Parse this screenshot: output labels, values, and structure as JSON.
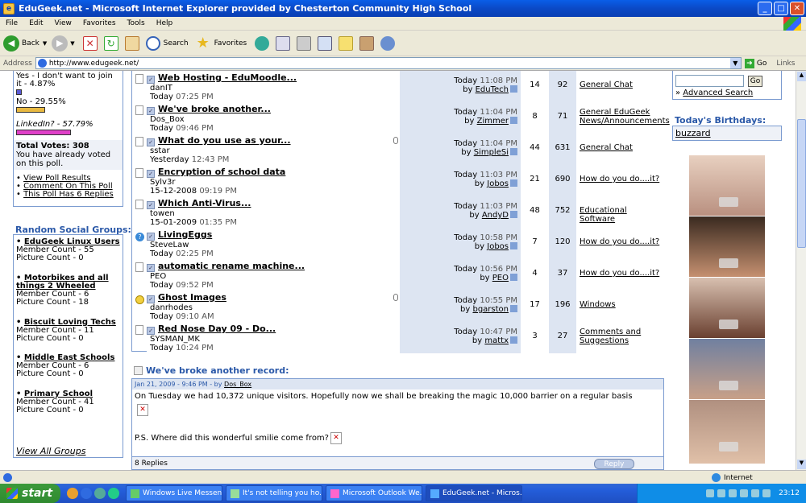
{
  "window": {
    "title": "EduGeek.net - Microsoft Internet Explorer provided by Chesterton Community High School"
  },
  "menu": [
    "File",
    "Edit",
    "View",
    "Favorites",
    "Tools",
    "Help"
  ],
  "toolbar": {
    "back": "Back",
    "search": "Search",
    "favorites": "Favorites"
  },
  "address": {
    "label": "Address",
    "url": "http://www.edugeek.net/",
    "go": "Go",
    "links": "Links"
  },
  "poll": {
    "options": [
      {
        "text": "Yes - I don't want to join it - 4.87%",
        "pct": 4.87,
        "color": "#5a5ad8"
      },
      {
        "text": "No - 29.55%",
        "pct": 29.55,
        "color": "#e8b840"
      },
      {
        "text": "LinkedIn? - 57.79%",
        "pct": 57.79,
        "color": "#e040c8"
      }
    ],
    "total": "Total Votes: 308",
    "voted": "You have already voted on this poll.",
    "links": [
      "View Poll Results",
      "Comment On This Poll",
      "This Poll Has 6 Replies"
    ]
  },
  "groups": {
    "heading": "Random Social Groups:",
    "items": [
      {
        "name": "EduGeek Linux Users",
        "members": "Member Count - 55",
        "pictures": "Picture Count - 0"
      },
      {
        "name": "Motorbikes and all things 2 Wheeled",
        "members": "Member Count - 6",
        "pictures": "Picture Count - 18"
      },
      {
        "name": "Biscuit Loving Techs",
        "members": "Member Count - 11",
        "pictures": "Picture Count - 0"
      },
      {
        "name": "Middle East Schools",
        "members": "Member Count - 6",
        "pictures": "Picture Count - 0"
      },
      {
        "name": "Primary School",
        "members": "Member Count - 41",
        "pictures": "Picture Count - 0"
      }
    ],
    "view_all": "View All Groups"
  },
  "threads": [
    {
      "title": "Web Hosting - EduMoodle...",
      "author": "danIT",
      "date": "Today",
      "time": "07:25 PM",
      "last_date": "Today",
      "last_time": "11:08 PM",
      "last_by": "EduTech",
      "replies": "14",
      "views": "92",
      "forum": "General Chat"
    },
    {
      "title": "We've broke another...",
      "author": "Dos_Box",
      "date": "Today",
      "time": "09:46 PM",
      "last_date": "Today",
      "last_time": "11:04 PM",
      "last_by": "Zimmer",
      "replies": "8",
      "views": "71",
      "forum": "General EduGeek News/Announcements"
    },
    {
      "title": "What do you use as your...",
      "author": "sstar",
      "date": "Yesterday",
      "time": "12:43 PM",
      "last_date": "Today",
      "last_time": "11:04 PM",
      "last_by": "SimpleSi",
      "replies": "44",
      "views": "631",
      "forum": "General Chat"
    },
    {
      "title": "Encryption of school data",
      "author": "Sylv3r",
      "date": "15-12-2008",
      "time": "09:19 PM",
      "last_date": "Today",
      "last_time": "11:03 PM",
      "last_by": "Jobos",
      "replies": "21",
      "views": "690",
      "forum": "How do you do....it?"
    },
    {
      "title": "Which Anti-Virus...",
      "author": "towen",
      "date": "15-01-2009",
      "time": "01:35 PM",
      "last_date": "Today",
      "last_time": "11:03 PM",
      "last_by": "AndyD",
      "replies": "48",
      "views": "752",
      "forum": "Educational Software"
    },
    {
      "title": "LivingEggs",
      "author": "SteveLaw",
      "date": "Today",
      "time": "02:25 PM",
      "last_date": "Today",
      "last_time": "10:58 PM",
      "last_by": "Jobos",
      "replies": "7",
      "views": "120",
      "forum": "How do you do....it?"
    },
    {
      "title": "automatic rename machine...",
      "author": "PEO",
      "date": "Today",
      "time": "09:52 PM",
      "last_date": "Today",
      "last_time": "10:56 PM",
      "last_by": "PEO",
      "replies": "4",
      "views": "37",
      "forum": "How do you do....it?"
    },
    {
      "title": "Ghost Images",
      "author": "danrhodes",
      "date": "Today",
      "time": "09:10 AM",
      "last_date": "Today",
      "last_time": "10:55 PM",
      "last_by": "bgarston",
      "replies": "17",
      "views": "196",
      "forum": "Windows"
    },
    {
      "title": "Red Nose Day 09 - Do...",
      "author": "SYSMAN_MK",
      "date": "Today",
      "time": "10:24 PM",
      "last_date": "Today",
      "last_time": "10:47 PM",
      "last_by": "mattx",
      "replies": "3",
      "views": "27",
      "forum": "Comments and Suggestions"
    }
  ],
  "post": {
    "title": "We've broke another record:",
    "meta_date": "Jan 21, 2009 - 9:46 PM - by",
    "meta_author": "Dos_Box",
    "body1": "On Tuesday we had 10,372 unique visitors. Hopefully now we shall be breaking the magic 10,000 barrier on a regular basis",
    "body2": "P.S. Where did this wonderful smilie come from?",
    "replies": "8 Replies",
    "reply_btn": "Reply"
  },
  "right": {
    "go": "Go",
    "advanced": "Advanced Search",
    "birthdays_heading": "Today's Birthdays:",
    "birthday_user": "buzzard"
  },
  "status": {
    "zone": "Internet"
  },
  "taskbar": {
    "start": "start",
    "tasks": [
      "Windows Live Messen...",
      "It's not telling you ho...",
      "Microsoft Outlook We...",
      "EduGeek.net - Micros..."
    ],
    "clock": "23:12"
  }
}
